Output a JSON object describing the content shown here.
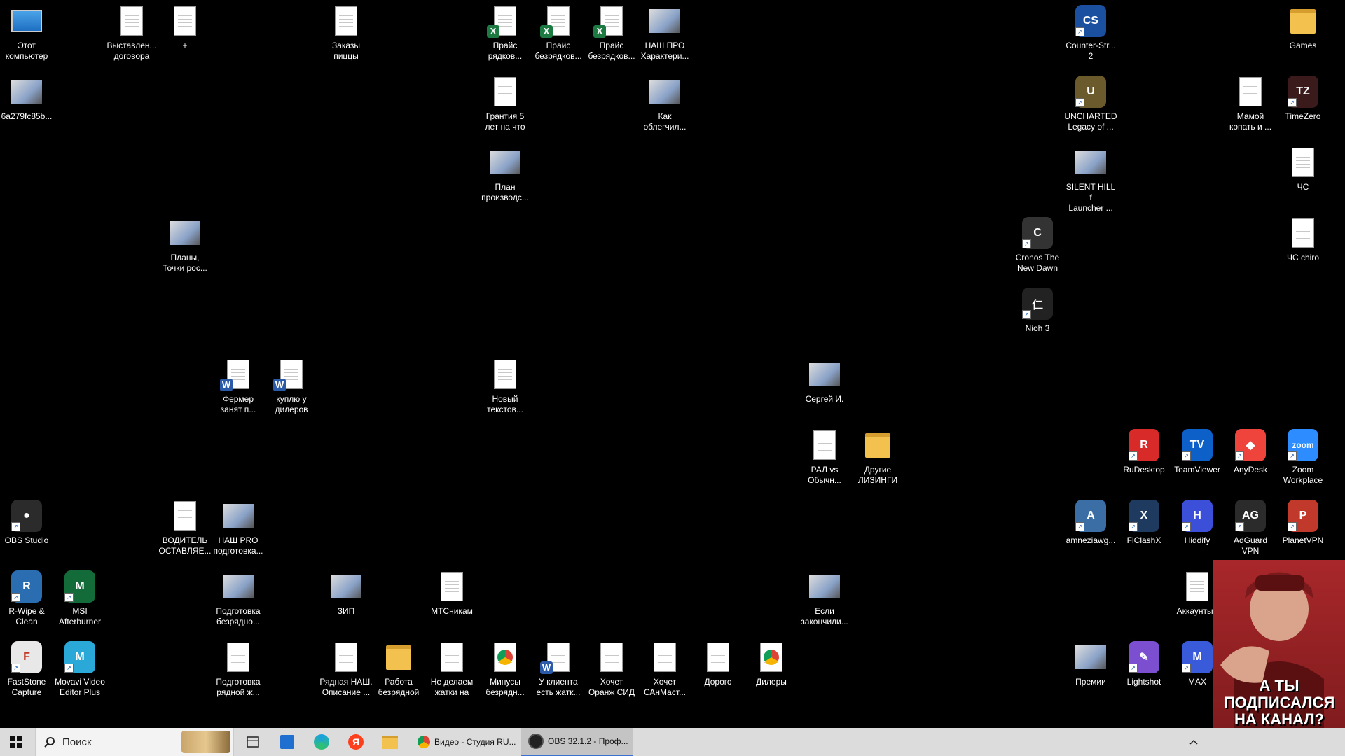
{
  "icons": [
    {
      "id": "this-pc",
      "label": "Этот\nкомпьютер",
      "kind": "computer"
    },
    {
      "id": "vystavlen",
      "label": "Выставлен...\nдоговора",
      "kind": "doc"
    },
    {
      "id": "plus",
      "label": "+",
      "kind": "doc"
    },
    {
      "id": "pizza",
      "label": "Заказы\nпиццы",
      "kind": "doc"
    },
    {
      "id": "price-ryadk",
      "label": "Прайс\nрядков...",
      "kind": "excel"
    },
    {
      "id": "price-bez1",
      "label": "Прайс\nбезрядков...",
      "kind": "excel"
    },
    {
      "id": "price-bez2",
      "label": "Прайс\nбезрядков...",
      "kind": "excel"
    },
    {
      "id": "nash-pro-har",
      "label": "НАШ ПРО\nХарактери...",
      "kind": "thumb"
    },
    {
      "id": "counter-strike",
      "label": "Counter-Str...\n2",
      "kind": "app"
    },
    {
      "id": "games",
      "label": "Games",
      "kind": "folder"
    },
    {
      "id": "img-6a",
      "label": "6a279fc85b...",
      "kind": "thumb"
    },
    {
      "id": "garantiya",
      "label": "Грантия 5\nлет на что",
      "kind": "doc"
    },
    {
      "id": "kak-oblegch",
      "label": "Как\nоблегчил...",
      "kind": "thumb"
    },
    {
      "id": "uncharted",
      "label": "UNCHARTED\nLegacy of ...",
      "kind": "app"
    },
    {
      "id": "mamoy",
      "label": "Мамой\nкопать и ...",
      "kind": "doc"
    },
    {
      "id": "timezero",
      "label": "TimeZero",
      "kind": "app"
    },
    {
      "id": "plan-proizv",
      "label": "План\nпроизводс...",
      "kind": "thumb"
    },
    {
      "id": "silent-hill",
      "label": "SILENT HILL f\nLauncher ...",
      "kind": "thumb"
    },
    {
      "id": "chs",
      "label": "ЧС",
      "kind": "doc"
    },
    {
      "id": "plany",
      "label": "Планы,\nТочки рос...",
      "kind": "thumb"
    },
    {
      "id": "cronos",
      "label": "Cronos The\nNew Dawn",
      "kind": "app"
    },
    {
      "id": "chs-chiro",
      "label": "ЧС chiro",
      "kind": "doc"
    },
    {
      "id": "nioh",
      "label": "Nioh 3",
      "kind": "app"
    },
    {
      "id": "fermer",
      "label": "Фермер\nзанят п...",
      "kind": "word"
    },
    {
      "id": "kuplyu",
      "label": "куплю у\nдилеров",
      "kind": "word"
    },
    {
      "id": "noviy-txt",
      "label": "Новый\nтекстов...",
      "kind": "doc"
    },
    {
      "id": "sergey",
      "label": "Сергей И.",
      "kind": "thumb"
    },
    {
      "id": "ral",
      "label": "РАЛ vs\nОбычн...",
      "kind": "doc"
    },
    {
      "id": "drugie",
      "label": "Другие\nЛИЗИНГИ",
      "kind": "folder"
    },
    {
      "id": "rudesktop",
      "label": "RuDesktop",
      "kind": "app"
    },
    {
      "id": "teamviewer",
      "label": "TeamViewer",
      "kind": "app"
    },
    {
      "id": "anydesk",
      "label": "AnyDesk",
      "kind": "app"
    },
    {
      "id": "zoom",
      "label": "Zoom\nWorkplace",
      "kind": "app"
    },
    {
      "id": "obs",
      "label": "OBS Studio",
      "kind": "app"
    },
    {
      "id": "voditel",
      "label": "ВОДИТЕЛЬ\nОСТАВЛЯЕ...",
      "kind": "doc"
    },
    {
      "id": "nash-pro-podg",
      "label": "НАШ PRO\nподготовка...",
      "kind": "thumb"
    },
    {
      "id": "amnezia",
      "label": "amneziawg...",
      "kind": "app"
    },
    {
      "id": "flclashx",
      "label": "FlClashX",
      "kind": "app"
    },
    {
      "id": "hiddify",
      "label": "Hiddify",
      "kind": "app"
    },
    {
      "id": "adguard",
      "label": "AdGuard\nVPN",
      "kind": "app"
    },
    {
      "id": "planetvpn",
      "label": "PlanetVPN",
      "kind": "app"
    },
    {
      "id": "rwipe",
      "label": "R-Wipe &\nClean",
      "kind": "app"
    },
    {
      "id": "msi",
      "label": "MSI\nAfterburner",
      "kind": "app"
    },
    {
      "id": "podg-bezr",
      "label": "Подготовка\nбезрядно...",
      "kind": "thumb"
    },
    {
      "id": "zip",
      "label": "ЗИП",
      "kind": "thumb"
    },
    {
      "id": "mts",
      "label": "МТСникам",
      "kind": "doc"
    },
    {
      "id": "esli",
      "label": "Если\nзакончили...",
      "kind": "thumb"
    },
    {
      "id": "akkaunty",
      "label": "Аккаунты I",
      "kind": "doc"
    },
    {
      "id": "faststone",
      "label": "FastStone\nCapture",
      "kind": "app"
    },
    {
      "id": "movavi",
      "label": "Movavi Video\nEditor Plus",
      "kind": "app"
    },
    {
      "id": "podg-ryad",
      "label": "Подготовка\nрядной ж...",
      "kind": "doc"
    },
    {
      "id": "ryadnaya",
      "label": "Рядная НАШ.\nОписание ...",
      "kind": "doc"
    },
    {
      "id": "rabota",
      "label": "Работа\nбезрядной",
      "kind": "folder"
    },
    {
      "id": "ne-delaem",
      "label": "Не делаем\nжатки на",
      "kind": "doc"
    },
    {
      "id": "minusy",
      "label": "Минусы\nбезрядн...",
      "kind": "chrome"
    },
    {
      "id": "u-klienta",
      "label": "У клиента\nесть жатк...",
      "kind": "word"
    },
    {
      "id": "oranzh",
      "label": "Хочет\nОранж СИД",
      "kind": "doc"
    },
    {
      "id": "sanmast",
      "label": "Хочет\nСАнМаст...",
      "kind": "doc"
    },
    {
      "id": "dorogo",
      "label": "Дорого",
      "kind": "doc"
    },
    {
      "id": "dilery",
      "label": "Дилеры",
      "kind": "chrome"
    },
    {
      "id": "premii",
      "label": "Премии",
      "kind": "thumb"
    },
    {
      "id": "lightshot",
      "label": "Lightshot",
      "kind": "app"
    },
    {
      "id": "max",
      "label": "MAX",
      "kind": "app"
    }
  ],
  "taskbar": {
    "search_placeholder": "Поиск",
    "tasks": [
      {
        "label": "Видео - Студия RU..."
      },
      {
        "label": "OBS 32.1.2 - Проф..."
      }
    ]
  },
  "overlay": {
    "caption": "А ТЫ ПОДПИСАЛСЯ\nНА КАНАЛ?"
  },
  "colors": {
    "desktop": "#000000",
    "taskbar": "#dcdcdc",
    "accent": "#3b6fd0"
  }
}
